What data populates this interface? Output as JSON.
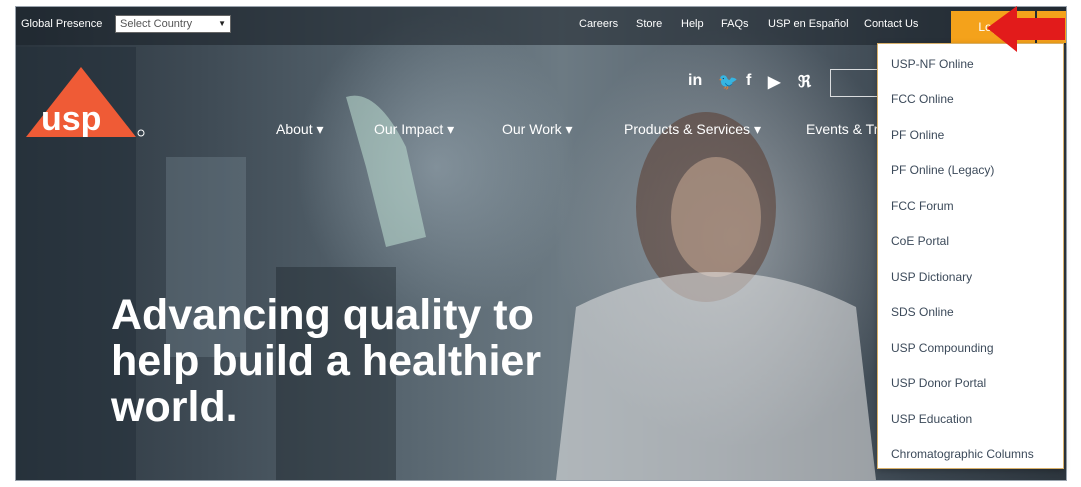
{
  "topbar": {
    "global_label": "Global Presence",
    "country_select_value": "Select Country",
    "links": [
      "Careers",
      "Store",
      "Help",
      "FAQs",
      "USP en Español",
      "Contact Us"
    ],
    "login_label": "Login"
  },
  "logo_text": "usp",
  "social_icons": [
    "linkedin-icon",
    "twitter-icon",
    "facebook-icon",
    "youtube-icon",
    "rss-icon"
  ],
  "social_glyphs": [
    "in",
    "🐦",
    "f",
    "▶",
    "ℜ"
  ],
  "nav": [
    "About",
    "Our Impact",
    "Our Work",
    "Products & Services",
    "Events & Tr"
  ],
  "headline": [
    "Advancing quality to",
    "help build a healthier",
    "world."
  ],
  "login_dropdown": [
    "USP-NF Online",
    "FCC Online",
    "PF Online",
    "PF Online (Legacy)",
    "FCC Forum",
    "CoE Portal",
    "USP Dictionary",
    "SDS Online",
    "USP Compounding",
    "USP Donor Portal",
    "USP Education",
    "Chromatographic Columns"
  ],
  "colors": {
    "login_orange": "#f4a21b",
    "logo_orange": "#ef5b36",
    "arrow_red": "#e21b1b",
    "dropdown_text": "#3c4a5a"
  }
}
